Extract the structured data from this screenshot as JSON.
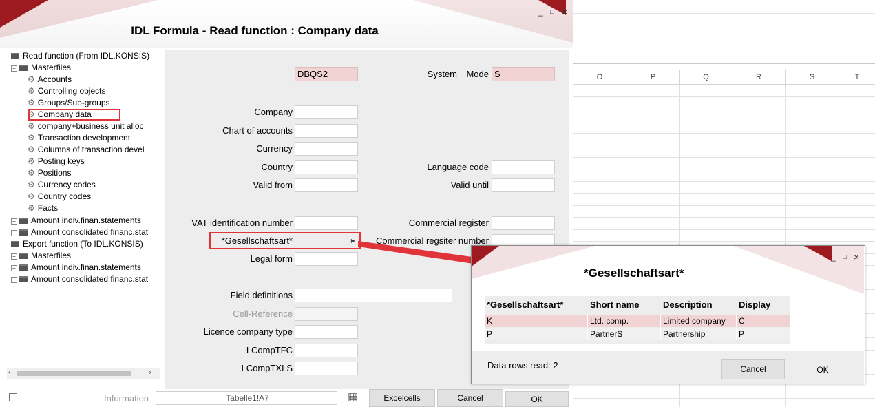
{
  "sheet": {
    "columns": [
      "O",
      "P",
      "Q",
      "R",
      "S",
      "T"
    ]
  },
  "dialog": {
    "title": "IDL Formula - Read function : Company data",
    "controls": {
      "minimize": "_",
      "maximize": "□",
      "close": "×"
    },
    "tree": [
      {
        "label": "Read function (From IDL.KONSIS)",
        "kind": "folder",
        "level": 0
      },
      {
        "label": "Masterfiles",
        "kind": "folder",
        "level": 1,
        "expander": "−"
      },
      {
        "label": "Accounts",
        "kind": "gear",
        "level": 2
      },
      {
        "label": "Controlling objects",
        "kind": "gear",
        "level": 2
      },
      {
        "label": "Groups/Sub-groups",
        "kind": "gear",
        "level": 2
      },
      {
        "label": "Company data",
        "kind": "gear",
        "level": 2,
        "selected": true
      },
      {
        "label": "company+business unit alloc",
        "kind": "gear",
        "level": 2
      },
      {
        "label": "Transaction development",
        "kind": "gear",
        "level": 2
      },
      {
        "label": "Columns of transaction devel",
        "kind": "gear",
        "level": 2
      },
      {
        "label": "Posting keys",
        "kind": "gear",
        "level": 2
      },
      {
        "label": "Positions",
        "kind": "gear",
        "level": 2
      },
      {
        "label": "Currency codes",
        "kind": "gear",
        "level": 2
      },
      {
        "label": "Country codes",
        "kind": "gear",
        "level": 2
      },
      {
        "label": "Facts",
        "kind": "gear",
        "level": 2
      },
      {
        "label": "Amount indiv.finan.statements",
        "kind": "folder",
        "level": 1,
        "expander": "+"
      },
      {
        "label": "Amount consolidated financ.stat",
        "kind": "folder",
        "level": 1,
        "expander": "+"
      },
      {
        "label": "Export function (To IDL.KONSIS)",
        "kind": "folder",
        "level": 0
      },
      {
        "label": "Masterfiles",
        "kind": "folder",
        "level": 1,
        "expander": "+"
      },
      {
        "label": "Amount indiv.finan.statements",
        "kind": "folder",
        "level": 1,
        "expander": "+"
      },
      {
        "label": "Amount consolidated financ.stat",
        "kind": "folder",
        "level": 1,
        "expander": "+"
      }
    ],
    "form": {
      "system_label": "System",
      "system_value": "DBQS2",
      "mode_label": "Mode",
      "mode_value": "S",
      "company": "Company",
      "chart": "Chart of accounts",
      "currency": "Currency",
      "country": "Country",
      "language": "Language code",
      "valid_from": "Valid from",
      "valid_until": "Valid until",
      "vat": "VAT identification number",
      "commercial_register": "Commercial register",
      "gesellschaftsart": "*Gesellschaftsart*",
      "commercial_register_number": "Commercial regsiter number",
      "legal_form": "Legal form",
      "field_definitions": "Field definitions",
      "cell_reference": "Cell-Reference",
      "licence_company_type": "Licence company type",
      "lcomptfc": "LCompTFC",
      "lcomptxls": "LCompTXLS"
    },
    "footer": {
      "information_label": "Information",
      "information_value": "Tabelle1!A7",
      "excelcells": "Excelcells",
      "cancel": "Cancel",
      "ok": "OK"
    }
  },
  "subdialog": {
    "title": "*Gesellschaftsart*",
    "controls": {
      "minimize": "_",
      "maximize": "□",
      "close": "×"
    },
    "headers": [
      "*Gesellschaftsart*",
      "Short name",
      "Description",
      "Display"
    ],
    "rows": [
      [
        "K",
        "Ltd. comp.",
        "Limited company",
        "C"
      ],
      [
        "P",
        "PartnerS",
        "Partnership",
        "P"
      ]
    ],
    "status": "Data rows read: 2",
    "cancel": "Cancel",
    "ok": "OK"
  },
  "colors": {
    "accent_red": "#9e1b22",
    "highlight_pink": "#f2d3d3",
    "callout_red": "#e0343a"
  }
}
